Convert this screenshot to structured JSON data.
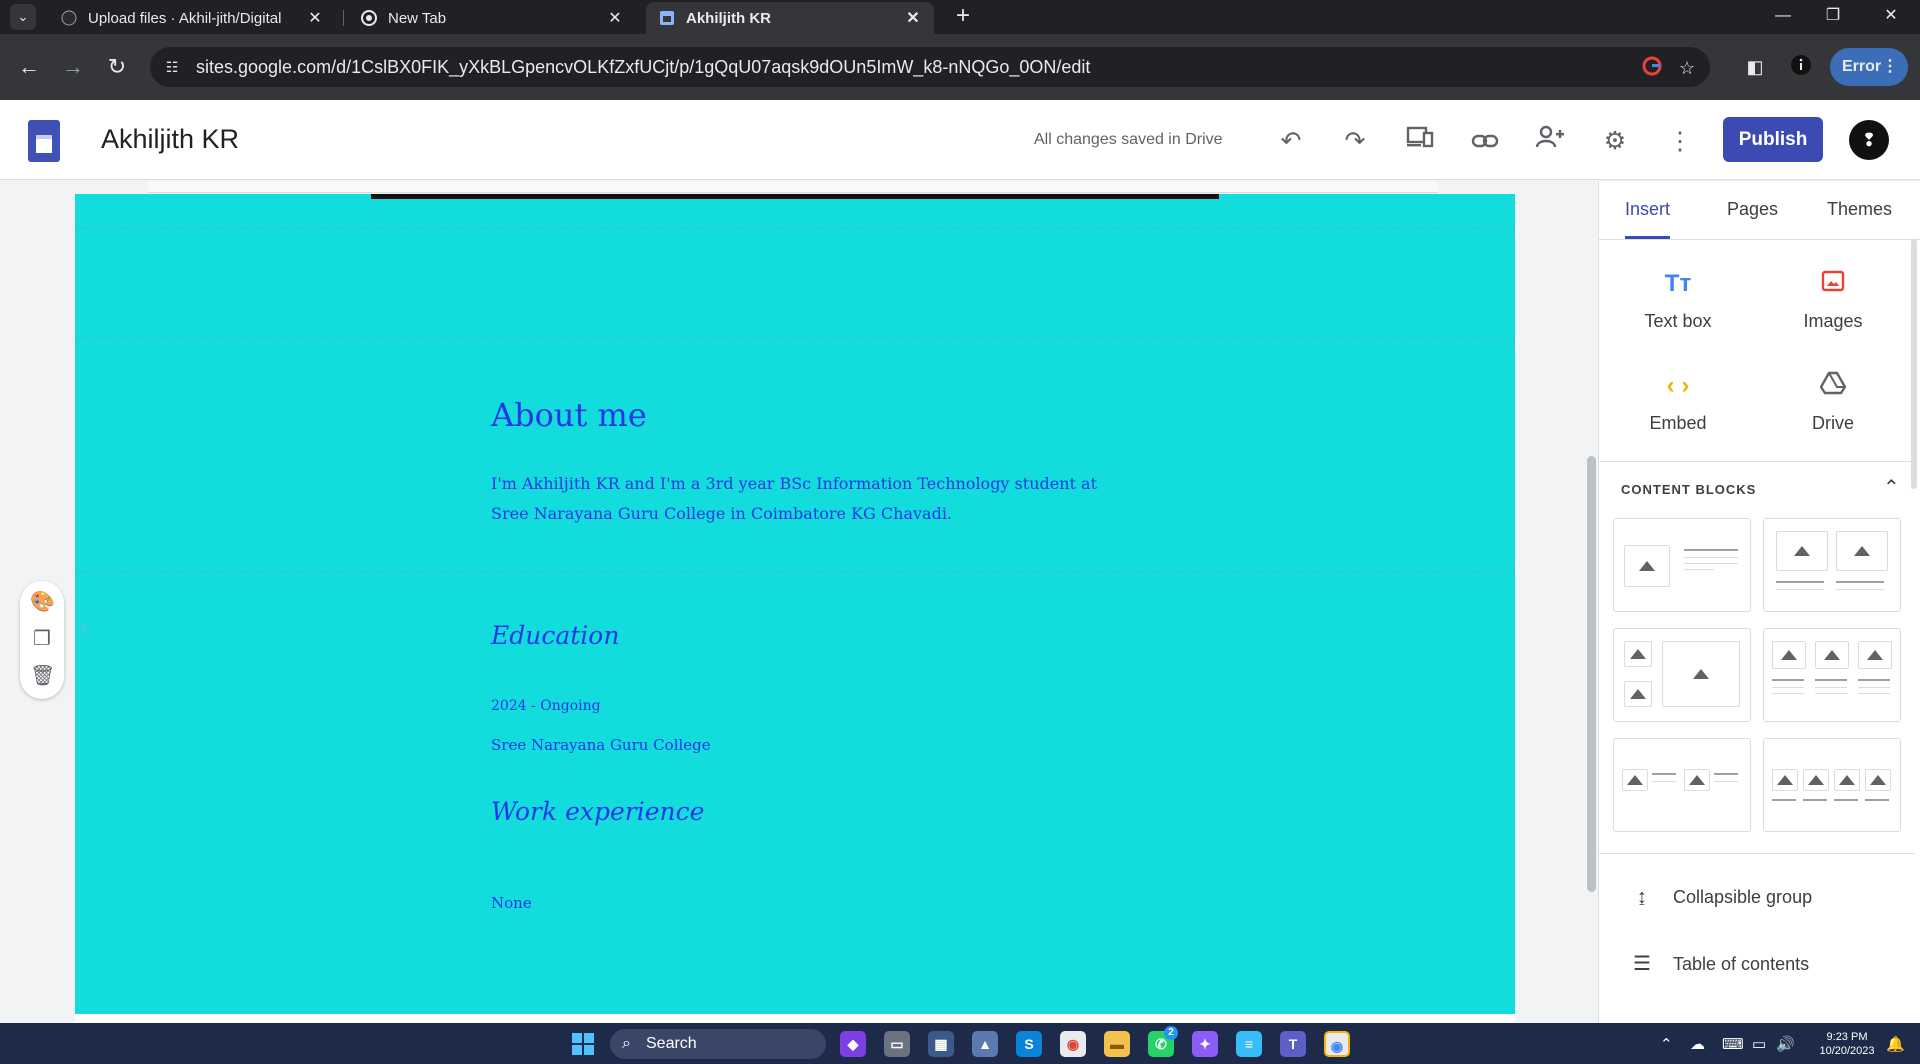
{
  "browser": {
    "tabs": [
      {
        "title": "Upload files · Akhil-jith/Digital",
        "icon": "github-icon"
      },
      {
        "title": "New Tab",
        "icon": "chrome-icon"
      },
      {
        "title": "Akhiljith KR",
        "icon": "google-sites-icon"
      }
    ],
    "url": "sites.google.com/d/1CslBX0FIK_yXkBLGpencvOLKfZxfUCjt/p/1gQqU07aqsk9dOUn5ImW_k8-nNQGo_0ON/edit",
    "profile_status": "Error"
  },
  "header": {
    "site_name": "Akhiljith KR",
    "save_status": "All changes saved in Drive",
    "publish_label": "Publish"
  },
  "page": {
    "about_heading": "About me",
    "about_text": "I'm Akhiljith KR and I'm a 3rd year BSc Information Technology student at Sree Narayana Guru College in Coimbatore KG Chavadi.",
    "education_heading": "Education",
    "education_years": "2024  - Ongoing",
    "education_college": "Sree Narayana Guru College",
    "work_heading": "Work experience",
    "work_text": "None",
    "background_color": "#12dcdc",
    "text_color": "#2337e8"
  },
  "panel": {
    "tabs": [
      "Insert",
      "Pages",
      "Themes"
    ],
    "active_tab": "Insert",
    "insert_items": [
      {
        "label": "Text box",
        "icon": "text-box-icon"
      },
      {
        "label": "Images",
        "icon": "image-icon"
      },
      {
        "label": "Embed",
        "icon": "embed-icon"
      },
      {
        "label": "Drive",
        "icon": "drive-icon"
      }
    ],
    "content_blocks_label": "CONTENT BLOCKS",
    "list_items": [
      {
        "label": "Collapsible group",
        "icon": "collapsible-icon"
      },
      {
        "label": "Table of contents",
        "icon": "toc-icon"
      }
    ]
  },
  "taskbar": {
    "search_label": "Search",
    "time": "9:23 PM",
    "date": "10/20/2023",
    "whatsapp_badge": "2"
  },
  "colors": {
    "accent": "#3c4ab3",
    "chrome_dark": "#202124",
    "taskbar": "#1e2a4a"
  }
}
